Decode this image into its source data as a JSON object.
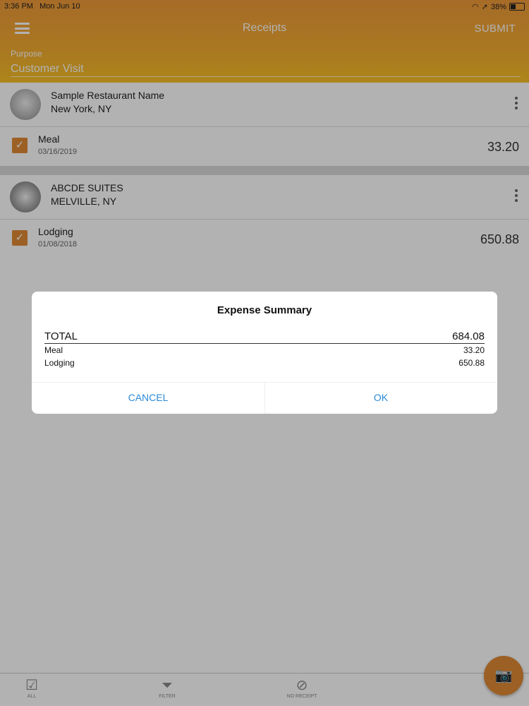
{
  "status": {
    "time": "3:36 PM",
    "date": "Mon Jun 10",
    "battery": "38%"
  },
  "header": {
    "title": "Receipts",
    "submit": "SUBMIT",
    "purpose_label": "Purpose",
    "purpose_value": "Customer Visit"
  },
  "receipts": [
    {
      "merchant": "Sample Restaurant Name",
      "location": "New York, NY",
      "category": "Meal",
      "date": "03/16/2019",
      "amount": "33.20"
    },
    {
      "merchant": "ABCDE SUITES",
      "location": "MELVILLE, NY",
      "category": "Lodging",
      "date": "01/08/2018",
      "amount": "650.88"
    }
  ],
  "dialog": {
    "title": "Expense Summary",
    "total_label": "TOTAL",
    "total_value": "684.08",
    "lines": [
      {
        "label": "Meal",
        "value": "33.20"
      },
      {
        "label": "Lodging",
        "value": "650.88"
      }
    ],
    "cancel": "CANCEL",
    "ok": "OK"
  },
  "bottom_tabs": [
    {
      "label": "ALL",
      "icon": "check-box-icon"
    },
    {
      "label": "FILTER",
      "icon": "filter-icon"
    },
    {
      "label": "NO RECEIPT",
      "icon": "no-receipt-icon"
    }
  ],
  "fab_icon": "camera-icon",
  "colors": {
    "accent": "#e08a36",
    "header_top": "#ef9a3a",
    "header_bottom": "#f6c026",
    "link": "#2b8ad6"
  }
}
